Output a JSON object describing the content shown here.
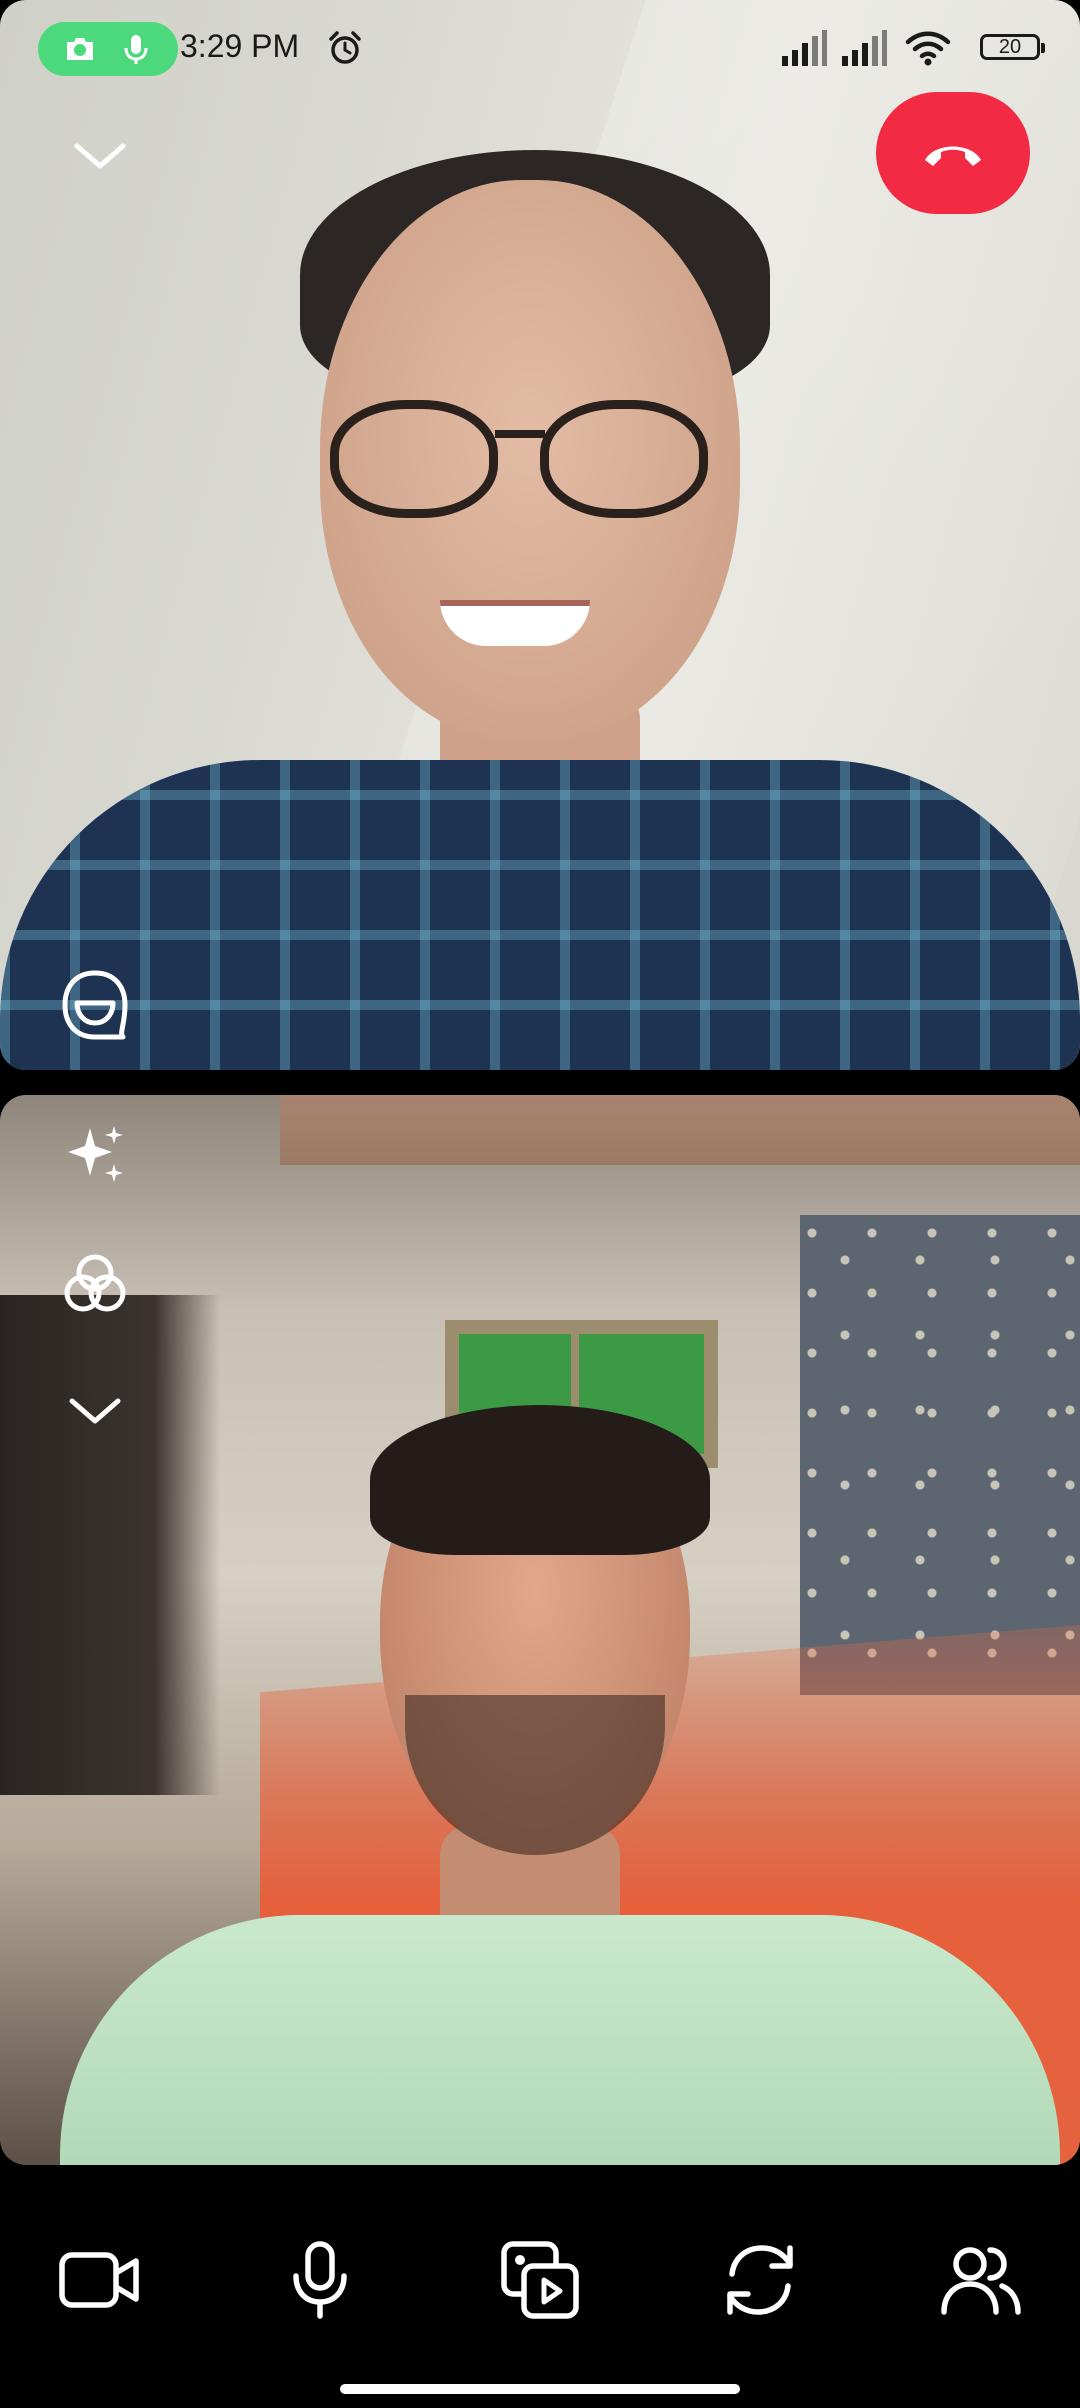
{
  "status_bar": {
    "time": "3:29 PM",
    "battery": "20",
    "indicator_pill_color": "#4cd97b",
    "icons": [
      "camera-in-use-icon",
      "mic-in-use-icon",
      "alarm-icon",
      "signal-icon",
      "signal-icon",
      "wifi-icon",
      "battery-icon"
    ]
  },
  "call": {
    "end_call_color": "#f32a44",
    "top_controls": [
      "collapse-chevron-icon",
      "end-call-icon"
    ],
    "remote_tile_controls": [
      "reactions-icon"
    ],
    "self_tile_controls": [
      "effects-sparkle-icon",
      "filters-icon",
      "collapse-chevron-icon"
    ]
  },
  "bottom_controls": [
    "video-camera-icon",
    "microphone-icon",
    "media-share-icon",
    "flip-camera-icon",
    "participants-icon"
  ]
}
